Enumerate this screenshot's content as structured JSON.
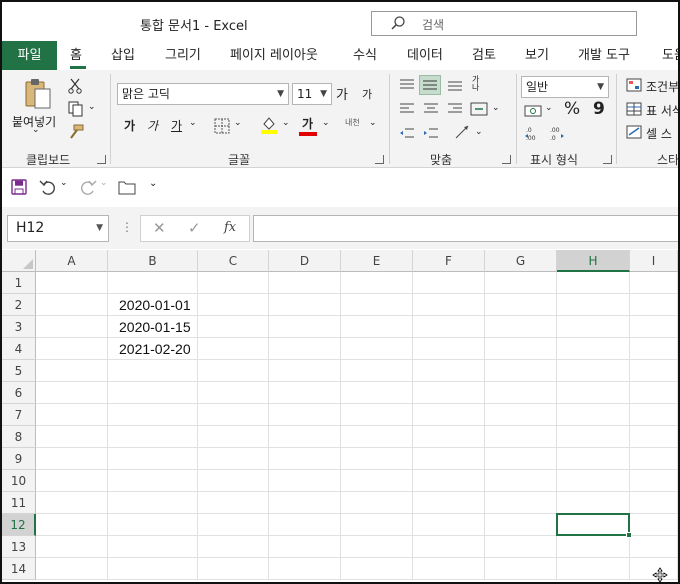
{
  "window": {
    "title": "통합 문서1  -  Excel"
  },
  "search": {
    "placeholder": "검색",
    "icon": "search-icon"
  },
  "ribbon_tabs": [
    {
      "label": "파일"
    },
    {
      "label": "홈"
    },
    {
      "label": "삽입"
    },
    {
      "label": "그리기"
    },
    {
      "label": "페이지 레이아웃"
    },
    {
      "label": "수식"
    },
    {
      "label": "데이터"
    },
    {
      "label": "검토"
    },
    {
      "label": "보기"
    },
    {
      "label": "개발 도구"
    },
    {
      "label": "도움"
    }
  ],
  "ribbon": {
    "clipboard": {
      "paste_label": "붙여넣기",
      "group_label": "클립보드"
    },
    "font": {
      "font_name": "맑은 고딕",
      "font_size": "11",
      "bold": "가",
      "italic": "가",
      "underline": "가",
      "font_color_char": "가",
      "grow": "가",
      "shrink": "가",
      "phonetic": "내천",
      "group_label": "글꼴"
    },
    "alignment": {
      "group_label": "맞춤",
      "wrap_label": "가나"
    },
    "number": {
      "format": "일반",
      "group_label": "표시 형식",
      "percent": "%",
      "comma": "9"
    },
    "styles": {
      "conditional": "조건부",
      "table": "표 서식",
      "cell": "셀 스",
      "group_label": "스타"
    }
  },
  "colors": {
    "accent": "#217346",
    "font_color": "#e00000",
    "highlight": "#ffff00"
  },
  "formula_bar": {
    "name_box": "H12",
    "fx": "fx",
    "value": ""
  },
  "columns": [
    "A",
    "B",
    "C",
    "D",
    "E",
    "F",
    "G",
    "H",
    "I"
  ],
  "rows": [
    "1",
    "2",
    "3",
    "4",
    "5",
    "6",
    "7",
    "8",
    "9",
    "10",
    "11",
    "12",
    "13",
    "14"
  ],
  "cells": {
    "B2": "2020-01-01",
    "B3": "2020-01-15",
    "B4": "2021-02-20"
  },
  "active_cell": {
    "column": "H",
    "row": "12"
  }
}
